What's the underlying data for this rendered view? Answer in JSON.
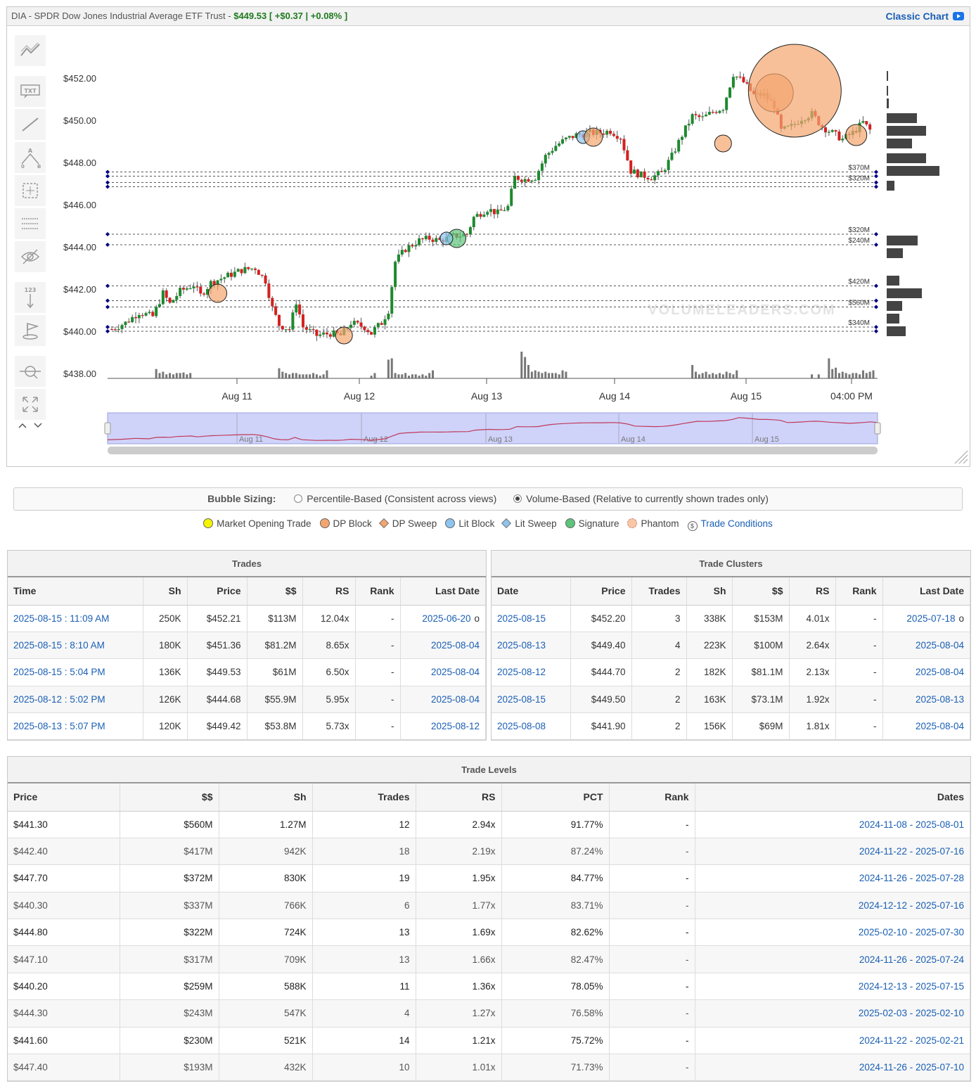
{
  "header": {
    "ticker_title": "DIA - SPDR Dow Jones Industrial Average ETF Trust - ",
    "price": "$449.53",
    "change": "[ +$0.37 | +0.08% ]",
    "classic_chart_label": "Classic Chart"
  },
  "toolbar": {
    "icons": [
      "trend-lines-icon",
      "text-annotation-icon",
      "line-draw-icon",
      "measure-ab-icon",
      "crosshair-select-icon",
      "horizontal-lines-icon",
      "hide-drawings-icon",
      "sort-123-icon",
      "flag-icon",
      "zoom-pan-icon",
      "fullscreen-icon",
      "chevron-up-icon",
      "chevron-down-icon"
    ]
  },
  "chart_data": {
    "type": "candlestick",
    "y_ticks": [
      "$452.00",
      "$450.00",
      "$448.00",
      "$446.00",
      "$444.00",
      "$442.00",
      "$440.00",
      "$438.00"
    ],
    "ylim": [
      437.9,
      453.2
    ],
    "x_ticks": [
      "Aug 11",
      "Aug 12",
      "Aug 13",
      "Aug 14",
      "Aug 15",
      "04:00 PM"
    ],
    "navigator_labels": [
      "Aug 11",
      "Aug 12",
      "Aug 13",
      "Aug 14",
      "Aug 15"
    ],
    "watermark": "VOLUMELEADERS.COM",
    "level_lines": [
      {
        "price": 447.55,
        "label": "$370M"
      },
      {
        "price": 447.35,
        "label": ""
      },
      {
        "price": 447.05,
        "label": "$320M"
      },
      {
        "price": 446.85,
        "label": ""
      },
      {
        "price": 444.6,
        "label": "$320M"
      },
      {
        "price": 444.1,
        "label": "$240M"
      },
      {
        "price": 442.15,
        "label": "$420M"
      },
      {
        "price": 441.45,
        "label": ""
      },
      {
        "price": 441.15,
        "label": "$560M"
      },
      {
        "price": 440.2,
        "label": "$340M"
      },
      {
        "price": 440.0,
        "label": ""
      }
    ],
    "price_path": [
      [
        0,
        440.1
      ],
      [
        4,
        440.4
      ],
      [
        8,
        440.9
      ],
      [
        12,
        440.7
      ],
      [
        15,
        441.8
      ],
      [
        17,
        441.3
      ],
      [
        20,
        441.9
      ],
      [
        24,
        442.2
      ],
      [
        26,
        441.7
      ],
      [
        29,
        442.3
      ],
      [
        32,
        442.5
      ],
      [
        35,
        442.7
      ],
      [
        38,
        442.9
      ],
      [
        42,
        443.0
      ],
      [
        45,
        442.4
      ],
      [
        47,
        441.1
      ],
      [
        49,
        440.3
      ],
      [
        52,
        440.1
      ],
      [
        54,
        441.4
      ],
      [
        56,
        440.2
      ],
      [
        60,
        439.8
      ],
      [
        64,
        439.9
      ],
      [
        67,
        439.8
      ],
      [
        70,
        440.4
      ],
      [
        74,
        440.2
      ],
      [
        76,
        439.9
      ],
      [
        77,
        440.1
      ],
      [
        79,
        440.4
      ],
      [
        81,
        441.0
      ],
      [
        83,
        443.3
      ],
      [
        86,
        443.9
      ],
      [
        90,
        444.3
      ],
      [
        93,
        444.4
      ],
      [
        96,
        444.3
      ],
      [
        100,
        444.5
      ],
      [
        104,
        444.6
      ],
      [
        106,
        445.4
      ],
      [
        110,
        445.8
      ],
      [
        113,
        445.6
      ],
      [
        116,
        445.9
      ],
      [
        118,
        447.3
      ],
      [
        121,
        447.2
      ],
      [
        124,
        447.3
      ],
      [
        127,
        448.3
      ],
      [
        130,
        448.8
      ],
      [
        133,
        449.1
      ],
      [
        136,
        449.3
      ],
      [
        140,
        449.4
      ],
      [
        143,
        449.4
      ],
      [
        146,
        449.5
      ],
      [
        149,
        449.2
      ],
      [
        152,
        447.6
      ],
      [
        155,
        447.4
      ],
      [
        158,
        447.3
      ],
      [
        161,
        447.5
      ],
      [
        164,
        448.3
      ],
      [
        167,
        449.3
      ],
      [
        170,
        450.2
      ],
      [
        173,
        450.1
      ],
      [
        176,
        450.4
      ],
      [
        179,
        450.6
      ],
      [
        182,
        452.2
      ],
      [
        185,
        451.8
      ],
      [
        188,
        451.2
      ],
      [
        191,
        451.2
      ],
      [
        194,
        450.7
      ],
      [
        196,
        449.5
      ],
      [
        199,
        449.7
      ],
      [
        202,
        450.1
      ],
      [
        205,
        450.3
      ],
      [
        208,
        449.7
      ],
      [
        211,
        449.4
      ],
      [
        214,
        449.1
      ],
      [
        217,
        449.4
      ],
      [
        220,
        449.9
      ],
      [
        222,
        449.53
      ]
    ],
    "volume_bars": [
      0.0,
      0.0,
      0.0,
      0.0,
      0.0,
      0.0,
      0.0,
      0.0,
      0.0,
      0.0,
      0.0,
      0.0,
      0.0,
      0.35,
      0.2,
      0.25,
      0.15,
      0.2,
      0.15,
      0.2,
      0.2,
      0.22,
      0.15,
      0.2,
      0.0,
      0.0,
      0.0,
      0.0,
      0.0,
      0.0,
      0.0,
      0.0,
      0.0,
      0.0,
      0.0,
      0.0,
      0.0,
      0.0,
      0.0,
      0.0,
      0.0,
      0.0,
      0.0,
      0.0,
      0.0,
      0.0,
      0.0,
      0.0,
      0.0,
      0.38,
      0.25,
      0.2,
      0.15,
      0.2,
      0.2,
      0.15,
      0.15,
      0.15,
      0.15,
      0.2,
      0.15,
      0.1,
      0.15,
      0.3,
      0.0,
      0.0,
      0.0,
      0.0,
      0.0,
      0.0,
      0.0,
      0.0,
      0.0,
      0.0,
      0.0,
      0.0,
      0.1,
      0.2,
      0.0,
      0.0,
      0.0,
      0.7,
      0.75,
      0.2,
      0.15,
      0.15,
      0.2,
      0.1,
      0.15,
      0.15,
      0.1,
      0.15,
      0.1,
      0.2,
      0.3,
      0.0,
      0.0,
      0.0,
      0.0,
      0.0,
      0.0,
      0.0,
      0.0,
      0.0,
      0.0,
      0.0,
      0.0,
      0.0,
      0.0,
      0.0,
      0.0,
      0.0,
      0.0,
      0.0,
      0.0,
      0.0,
      0.0,
      0.0,
      0.0,
      0.0,
      1.0,
      0.8,
      0.5,
      0.25,
      0.3,
      0.25,
      0.2,
      0.25,
      0.2,
      0.2,
      0.2,
      0.15,
      0.3,
      0.25,
      0.0,
      0.0,
      0.0,
      0.0,
      0.0,
      0.0,
      0.0,
      0.0,
      0.0,
      0.0,
      0.0,
      0.0,
      0.0,
      0.0,
      0.0,
      0.0,
      0.0,
      0.0,
      0.0,
      0.0,
      0.0,
      0.0,
      0.0,
      0.0,
      0.0,
      0.0,
      0.0,
      0.0,
      0.0,
      0.0,
      0.0,
      0.0,
      0.0,
      0.0,
      0.0,
      0.0,
      0.5,
      0.25,
      0.15,
      0.2,
      0.25,
      0.15,
      0.2,
      0.15,
      0.2,
      0.15,
      0.25,
      0.2,
      0.15,
      0.3,
      0.0,
      0.0,
      0.0,
      0.0,
      0.0,
      0.0,
      0.0,
      0.0,
      0.0,
      0.0,
      0.0,
      0.0,
      0.0,
      0.0,
      0.0,
      0.0,
      0.0,
      0.0,
      0.0,
      0.0,
      0.0,
      0.15,
      0.0,
      0.15,
      0.0,
      0.0,
      0.75,
      0.35,
      0.4,
      0.2,
      0.25,
      0.2,
      0.15,
      0.2,
      0.2,
      0.15,
      0.3,
      0.2,
      0.25,
      0.3
    ],
    "bubbles": [
      {
        "i": 31,
        "price": 441.8,
        "r": 13,
        "kind": "dp-block"
      },
      {
        "i": 68,
        "price": 439.8,
        "r": 12,
        "kind": "dp-block"
      },
      {
        "i": 101,
        "price": 444.4,
        "r": 13,
        "kind": "signature"
      },
      {
        "i": 98,
        "price": 444.4,
        "r": 9,
        "kind": "lit-block"
      },
      {
        "i": 138,
        "price": 449.2,
        "r": 9,
        "kind": "lit-block"
      },
      {
        "i": 141,
        "price": 449.2,
        "r": 13,
        "kind": "dp-block"
      },
      {
        "i": 179,
        "price": 448.9,
        "r": 12,
        "kind": "dp-block"
      },
      {
        "i": 194,
        "price": 451.3,
        "r": 27,
        "kind": "dp-block"
      },
      {
        "i": 200,
        "price": 451.4,
        "r": 66,
        "kind": "dp-block"
      },
      {
        "i": 218,
        "price": 449.3,
        "r": 15,
        "kind": "dp-block"
      }
    ],
    "histogram": [
      {
        "price": 452.1,
        "w": 2
      },
      {
        "price": 451.4,
        "w": 2
      },
      {
        "price": 450.8,
        "w": 3
      },
      {
        "price": 450.1,
        "w": 43
      },
      {
        "price": 449.5,
        "w": 56
      },
      {
        "price": 448.9,
        "w": 36
      },
      {
        "price": 448.2,
        "w": 56
      },
      {
        "price": 447.6,
        "w": 75
      },
      {
        "price": 446.9,
        "w": 11
      },
      {
        "price": 444.3,
        "w": 44
      },
      {
        "price": 443.7,
        "w": 23
      },
      {
        "price": 442.4,
        "w": 18
      },
      {
        "price": 441.8,
        "w": 50
      },
      {
        "price": 441.2,
        "w": 22
      },
      {
        "price": 440.6,
        "w": 18
      },
      {
        "price": 440.0,
        "w": 27
      }
    ]
  },
  "bubble_sizing": {
    "label": "Bubble Sizing:",
    "option1": "Percentile-Based (Consistent across views)",
    "option2": "Volume-Based (Relative to currently shown trades only)",
    "selected": 2
  },
  "legend": {
    "items": [
      {
        "label": "Market Opening Trade",
        "color": "#f5f500",
        "shape": "circle"
      },
      {
        "label": "DP Block",
        "color": "#f4a56e",
        "shape": "circle"
      },
      {
        "label": "DP Sweep",
        "color": "#f4a56e",
        "shape": "diamond"
      },
      {
        "label": "Lit Block",
        "color": "#8ec4ee",
        "shape": "circle"
      },
      {
        "label": "Lit Sweep",
        "color": "#8ec4ee",
        "shape": "diamond"
      },
      {
        "label": "Signature",
        "color": "#5cc57a",
        "shape": "circle"
      },
      {
        "label": "Phantom",
        "color": "#f8c7a6",
        "shape": "phantom"
      }
    ],
    "trade_conditions": "Trade Conditions"
  },
  "trades": {
    "caption": "Trades",
    "columns": [
      "Time",
      "Sh",
      "Price",
      "$$",
      "RS",
      "Rank",
      "Last Date"
    ],
    "rows": [
      [
        "2025-08-15 : 11:09 AM",
        "250K",
        "$452.21",
        "$113M",
        "12.04x",
        "-",
        "2025-06-20",
        "o"
      ],
      [
        "2025-08-15 : 8:10 AM",
        "180K",
        "$451.36",
        "$81.2M",
        "8.65x",
        "-",
        "2025-08-04",
        ""
      ],
      [
        "2025-08-15 : 5:04 PM",
        "136K",
        "$449.53",
        "$61M",
        "6.50x",
        "-",
        "2025-08-04",
        ""
      ],
      [
        "2025-08-12 : 5:02 PM",
        "126K",
        "$444.68",
        "$55.9M",
        "5.95x",
        "-",
        "2025-08-04",
        ""
      ],
      [
        "2025-08-13 : 5:07 PM",
        "120K",
        "$449.42",
        "$53.8M",
        "5.73x",
        "-",
        "2025-08-12",
        ""
      ]
    ]
  },
  "clusters": {
    "caption": "Trade Clusters",
    "columns": [
      "Date",
      "Price",
      "Trades",
      "Sh",
      "$$",
      "RS",
      "Rank",
      "Last Date"
    ],
    "rows": [
      [
        "2025-08-15",
        "$452.20",
        "3",
        "338K",
        "$153M",
        "4.01x",
        "-",
        "2025-07-18",
        "o"
      ],
      [
        "2025-08-13",
        "$449.40",
        "4",
        "223K",
        "$100M",
        "2.64x",
        "-",
        "2025-08-04",
        ""
      ],
      [
        "2025-08-12",
        "$444.70",
        "2",
        "182K",
        "$81.1M",
        "2.13x",
        "-",
        "2025-08-04",
        ""
      ],
      [
        "2025-08-15",
        "$449.50",
        "2",
        "163K",
        "$73.1M",
        "1.92x",
        "-",
        "2025-08-13",
        ""
      ],
      [
        "2025-08-08",
        "$441.90",
        "2",
        "156K",
        "$69M",
        "1.81x",
        "-",
        "2025-08-04",
        ""
      ]
    ]
  },
  "levels": {
    "caption": "Trade Levels",
    "columns": [
      "Price",
      "$$",
      "Sh",
      "Trades",
      "RS",
      "PCT",
      "Rank",
      "Dates"
    ],
    "rows": [
      [
        "$441.30",
        "$560M",
        "1.27M",
        "12",
        "2.94x",
        "91.77%",
        "-",
        "2024-11-08 - 2025-08-01"
      ],
      [
        "$442.40",
        "$417M",
        "942K",
        "18",
        "2.19x",
        "87.24%",
        "-",
        "2024-11-22 - 2025-07-16"
      ],
      [
        "$447.70",
        "$372M",
        "830K",
        "19",
        "1.95x",
        "84.77%",
        "-",
        "2024-11-26 - 2025-07-28"
      ],
      [
        "$440.30",
        "$337M",
        "766K",
        "6",
        "1.77x",
        "83.71%",
        "-",
        "2024-12-12 - 2025-07-16"
      ],
      [
        "$444.80",
        "$322M",
        "724K",
        "13",
        "1.69x",
        "82.62%",
        "-",
        "2025-02-10 - 2025-07-30"
      ],
      [
        "$447.10",
        "$317M",
        "709K",
        "13",
        "1.66x",
        "82.47%",
        "-",
        "2024-11-26 - 2025-07-24"
      ],
      [
        "$440.20",
        "$259M",
        "588K",
        "11",
        "1.36x",
        "78.05%",
        "-",
        "2024-12-13 - 2025-07-15"
      ],
      [
        "$444.30",
        "$243M",
        "547K",
        "4",
        "1.27x",
        "76.58%",
        "-",
        "2025-02-03 - 2025-02-10"
      ],
      [
        "$441.60",
        "$230M",
        "521K",
        "14",
        "1.21x",
        "75.72%",
        "-",
        "2024-11-22 - 2025-02-21"
      ],
      [
        "$447.40",
        "$193M",
        "432K",
        "10",
        "1.01x",
        "71.73%",
        "-",
        "2024-11-26 - 2025-07-10"
      ]
    ]
  }
}
